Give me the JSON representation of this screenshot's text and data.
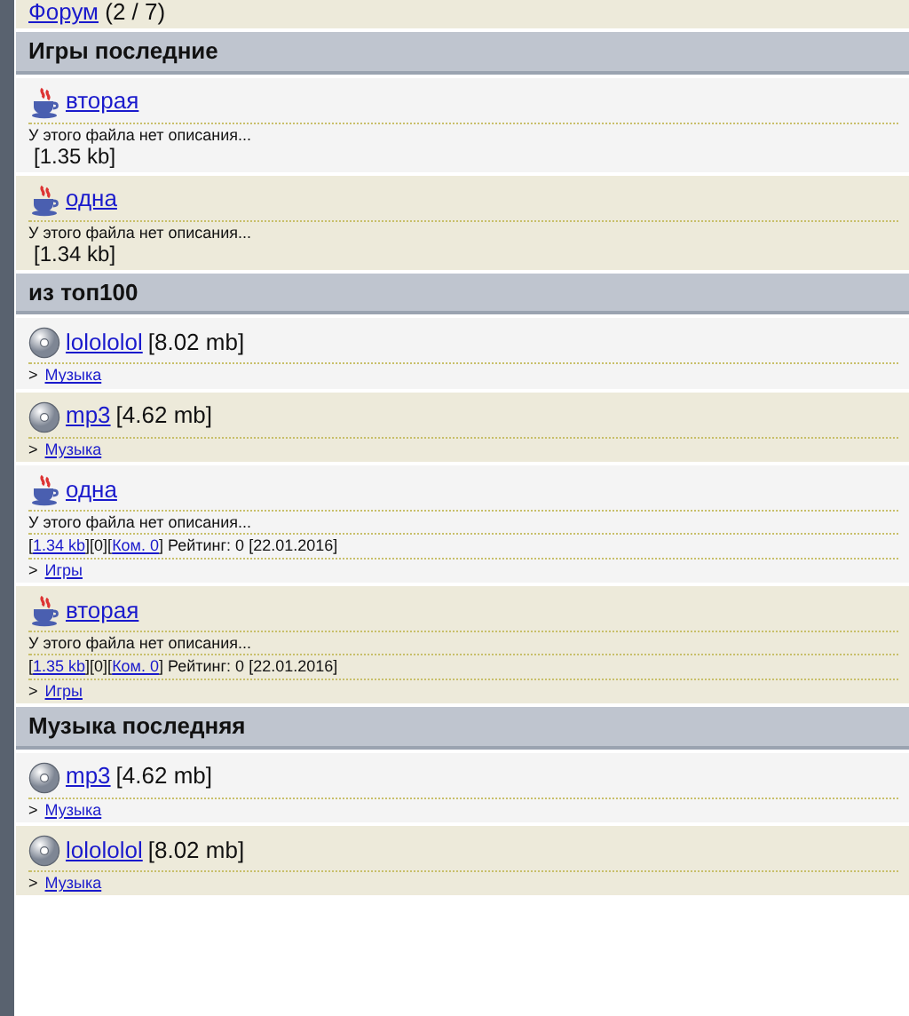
{
  "forum_line": {
    "link": "Форум",
    "count": "(2 / 7)"
  },
  "sections": [
    {
      "title": "Игры последние",
      "items": [
        {
          "kind": "game",
          "title": "вторая",
          "description": "У этого файла нет описания...",
          "size": "[1.35 kb]"
        },
        {
          "kind": "game",
          "title": "одна",
          "description": "У этого файла нет описания...",
          "size": "[1.34 kb]"
        }
      ]
    },
    {
      "title": "из топ100",
      "items": [
        {
          "kind": "music",
          "title": "lolololol",
          "size_inline": "[8.02 mb]",
          "category": {
            "prefix": ">",
            "label": "Музыка"
          }
        },
        {
          "kind": "music",
          "title": "mp3",
          "size_inline": "[4.62 mb]",
          "category": {
            "prefix": ">",
            "label": "Музыка"
          }
        },
        {
          "kind": "game",
          "title": "одна",
          "description": "У этого файла нет описания...",
          "meta": [
            {
              "text": "[",
              "kind": "text"
            },
            {
              "text": "1.34 kb",
              "kind": "link"
            },
            {
              "text": "][0][",
              "kind": "text"
            },
            {
              "text": "Ком. 0",
              "kind": "link"
            },
            {
              "text": "] Рейтинг: 0 [22.01.2016]",
              "kind": "text"
            }
          ],
          "category": {
            "prefix": ">",
            "label": "Игры"
          }
        },
        {
          "kind": "game",
          "title": "вторая",
          "description": "У этого файла нет описания...",
          "meta": [
            {
              "text": "[",
              "kind": "text"
            },
            {
              "text": "1.35 kb",
              "kind": "link"
            },
            {
              "text": "][0][",
              "kind": "text"
            },
            {
              "text": "Ком. 0",
              "kind": "link"
            },
            {
              "text": "] Рейтинг: 0 [22.01.2016]",
              "kind": "text"
            }
          ],
          "category": {
            "prefix": ">",
            "label": "Игры"
          }
        }
      ]
    },
    {
      "title": "Музыка последняя",
      "items": [
        {
          "kind": "music",
          "title": "mp3",
          "size_inline": "[4.62 mb]",
          "category": {
            "prefix": ">",
            "label": "Музыка"
          }
        },
        {
          "kind": "music",
          "title": "lolololol",
          "size_inline": "[8.02 mb]",
          "category": {
            "prefix": ">",
            "label": "Музыка"
          }
        }
      ]
    }
  ]
}
